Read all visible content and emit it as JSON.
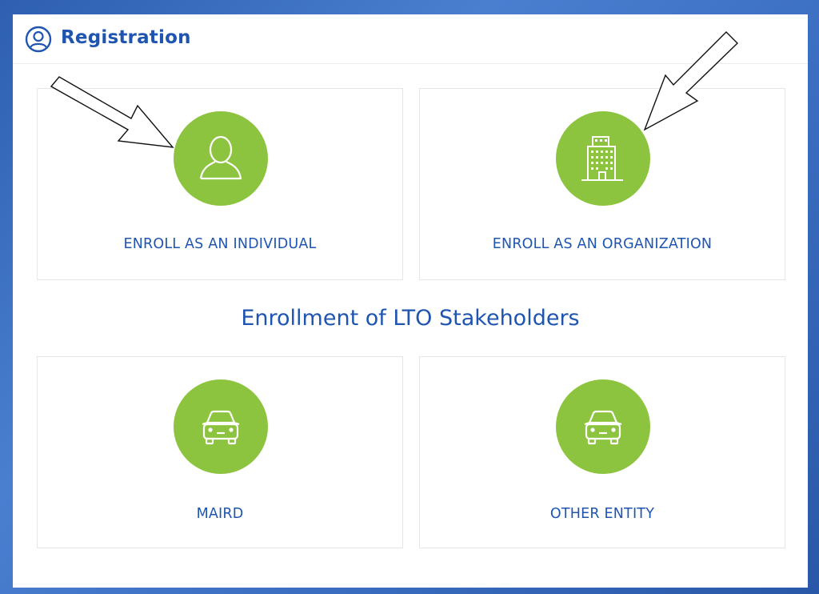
{
  "header": {
    "title": "Registration",
    "icon": "user-circle-icon"
  },
  "cards": {
    "individual": {
      "label": "ENROLL AS AN INDIVIDUAL",
      "icon": "person-icon"
    },
    "organization": {
      "label": "ENROLL AS AN ORGANIZATION",
      "icon": "building-icon"
    },
    "maird": {
      "label": "MAIRD",
      "icon": "car-icon"
    },
    "other": {
      "label": "OTHER ENTITY",
      "icon": "car-icon"
    }
  },
  "section": {
    "title": "Enrollment of LTO Stakeholders"
  },
  "colors": {
    "accent_blue": "#1f55b0",
    "icon_green": "#8dc43f",
    "background": "#3a6dc0"
  }
}
